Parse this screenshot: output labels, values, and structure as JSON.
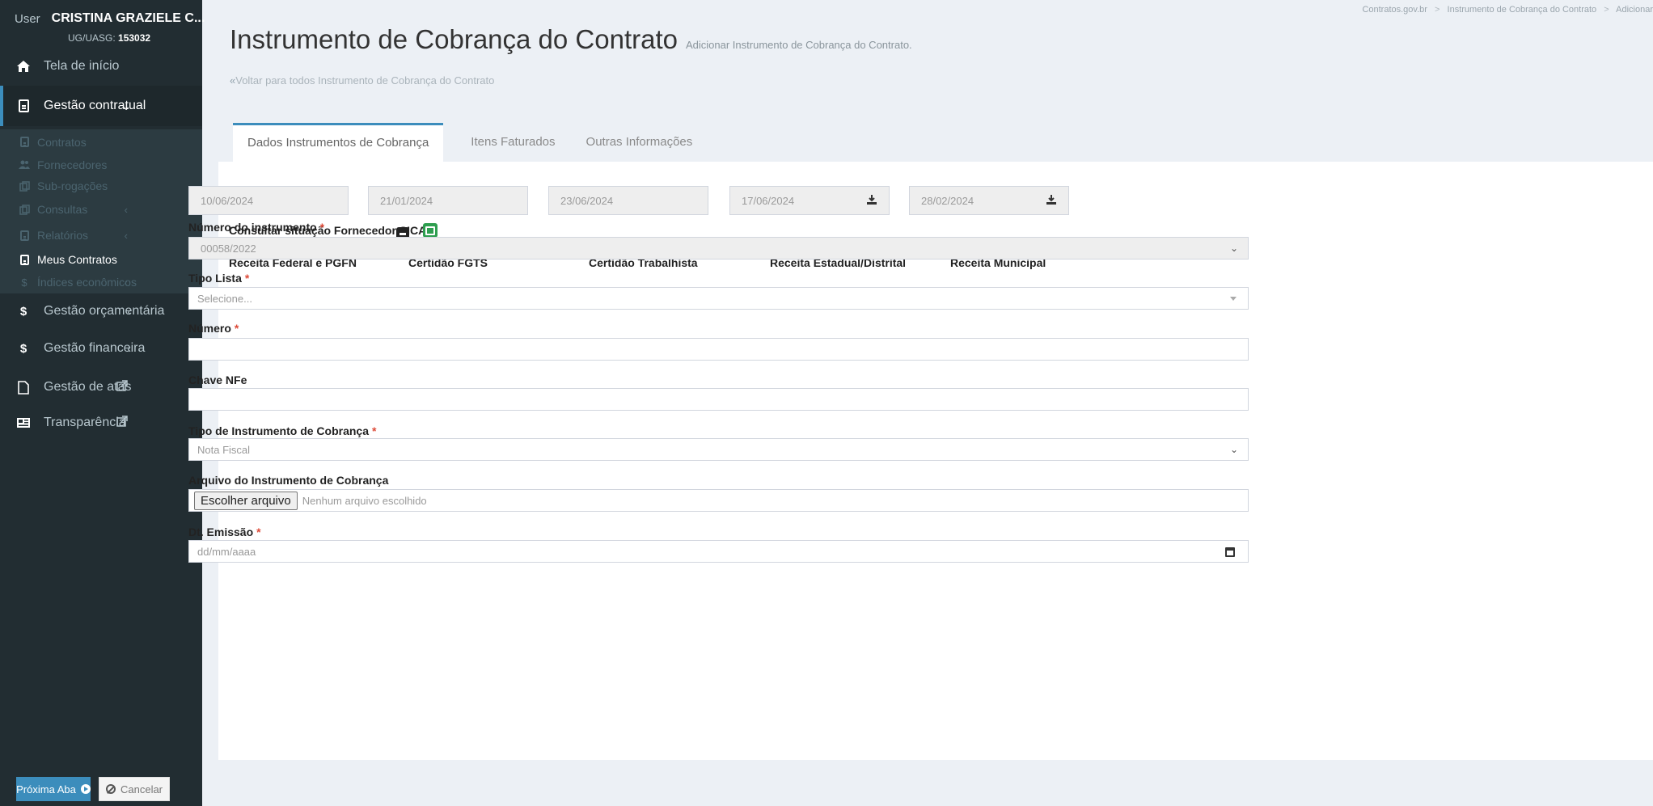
{
  "user": {
    "word": "User",
    "name": "CRISTINA GRAZIELE C...",
    "uasg_label": "UG/UASG:",
    "uasg_code": "153032"
  },
  "sidebar": {
    "home": "Tela de início",
    "contract_mgmt": "Gestão contratual",
    "sub": {
      "contratos": "Contratos",
      "fornecedores": "Fornecedores",
      "subrogacoes": "Sub-rogações",
      "consultas": "Consultas",
      "relatorios": "Relatórios",
      "meus_contratos": "Meus Contratos",
      "indices": "Índices econômicos"
    },
    "orcamentaria": "Gestão orçamentária",
    "financeira": "Gestão financeira",
    "atas": "Gestão de atas",
    "transparencia": "Transparência"
  },
  "breadcrumb": [
    "Contratos.gov.br",
    "Instrumento de Cobrança do Contrato",
    "Adicionar"
  ],
  "page": {
    "title": "Instrumento de Cobrança do Contrato",
    "subtitle": "Adicionar Instrumento de Cobrança do Contrato.",
    "back_link": "Voltar para todos Instrumento de Cobrança do Contrato"
  },
  "tabs": [
    "Dados Instrumentos de Cobrança",
    "Itens Faturados",
    "Outras Informações"
  ],
  "form": {
    "sicaf_label": "Consultar situação Fornecedor SICAF",
    "certidoes": [
      {
        "label": "Receita Federal e PGFN",
        "value": "10/06/2024"
      },
      {
        "label": "Certidão FGTS",
        "value": "21/01/2024"
      },
      {
        "label": "Certidão Trabalhista",
        "value": "23/06/2024"
      },
      {
        "label": "Receita Estadual/Distrital",
        "value": "17/06/2024"
      },
      {
        "label": "Receita Municipal",
        "value": "28/02/2024"
      }
    ],
    "numero_instrumento": {
      "label": "Número do instrumento",
      "value": "00058/2022"
    },
    "tipo_lista": {
      "label": "Tipo Lista",
      "placeholder": "Selecione..."
    },
    "numero": {
      "label": "Número",
      "value": ""
    },
    "chave_nfe": {
      "label": "Chave NFe",
      "value": ""
    },
    "tipo_instrumento": {
      "label": "Tipo de Instrumento de Cobrança",
      "value": "Nota Fiscal"
    },
    "arquivo": {
      "label": "Arquivo do Instrumento de Cobrança",
      "button": "Escolher arquivo",
      "status": "Nenhum arquivo escolhido"
    },
    "dt_emissao": {
      "label": "Dt. Emissão",
      "placeholder": "dd/mm/aaaa"
    },
    "required_mark": "*"
  },
  "actions": {
    "next": "Próxima Aba",
    "cancel": "Cancelar"
  },
  "colors": {
    "sidebar": "#222d32",
    "accent": "#3c8dbc",
    "sicaf_green": "#2e9e4f",
    "required": "#dd4b39"
  }
}
